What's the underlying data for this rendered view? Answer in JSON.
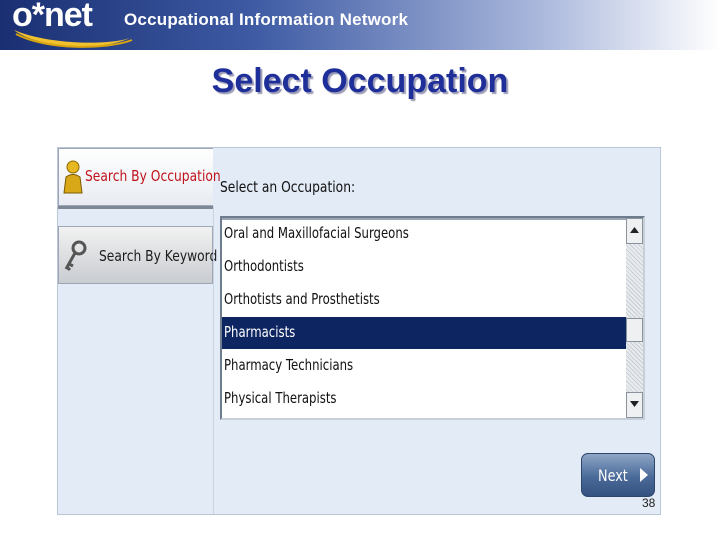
{
  "banner": {
    "logo_text": "o*net",
    "title": "Occupational Information Network"
  },
  "slide": {
    "title": "Select Occupation",
    "page_number": "38"
  },
  "tabs": [
    {
      "label": "Search By Occupation",
      "icon": "person-icon",
      "active": true
    },
    {
      "label": "Search By Keyword",
      "icon": "key-icon",
      "active": false
    }
  ],
  "main": {
    "select_label": "Select an Occupation:",
    "occupations": [
      "Oral and Maxillofacial Surgeons",
      "Orthodontists",
      "Orthotists and Prosthetists",
      "Pharmacists",
      "Pharmacy Technicians",
      "Physical Therapists"
    ],
    "selected": "Pharmacists",
    "next_label": "Next"
  },
  "colors": {
    "title": "#1f2f9a",
    "active_tab_text": "#c0141c",
    "selection": "#0d2560",
    "panel_bg": "#e2ebf6"
  }
}
